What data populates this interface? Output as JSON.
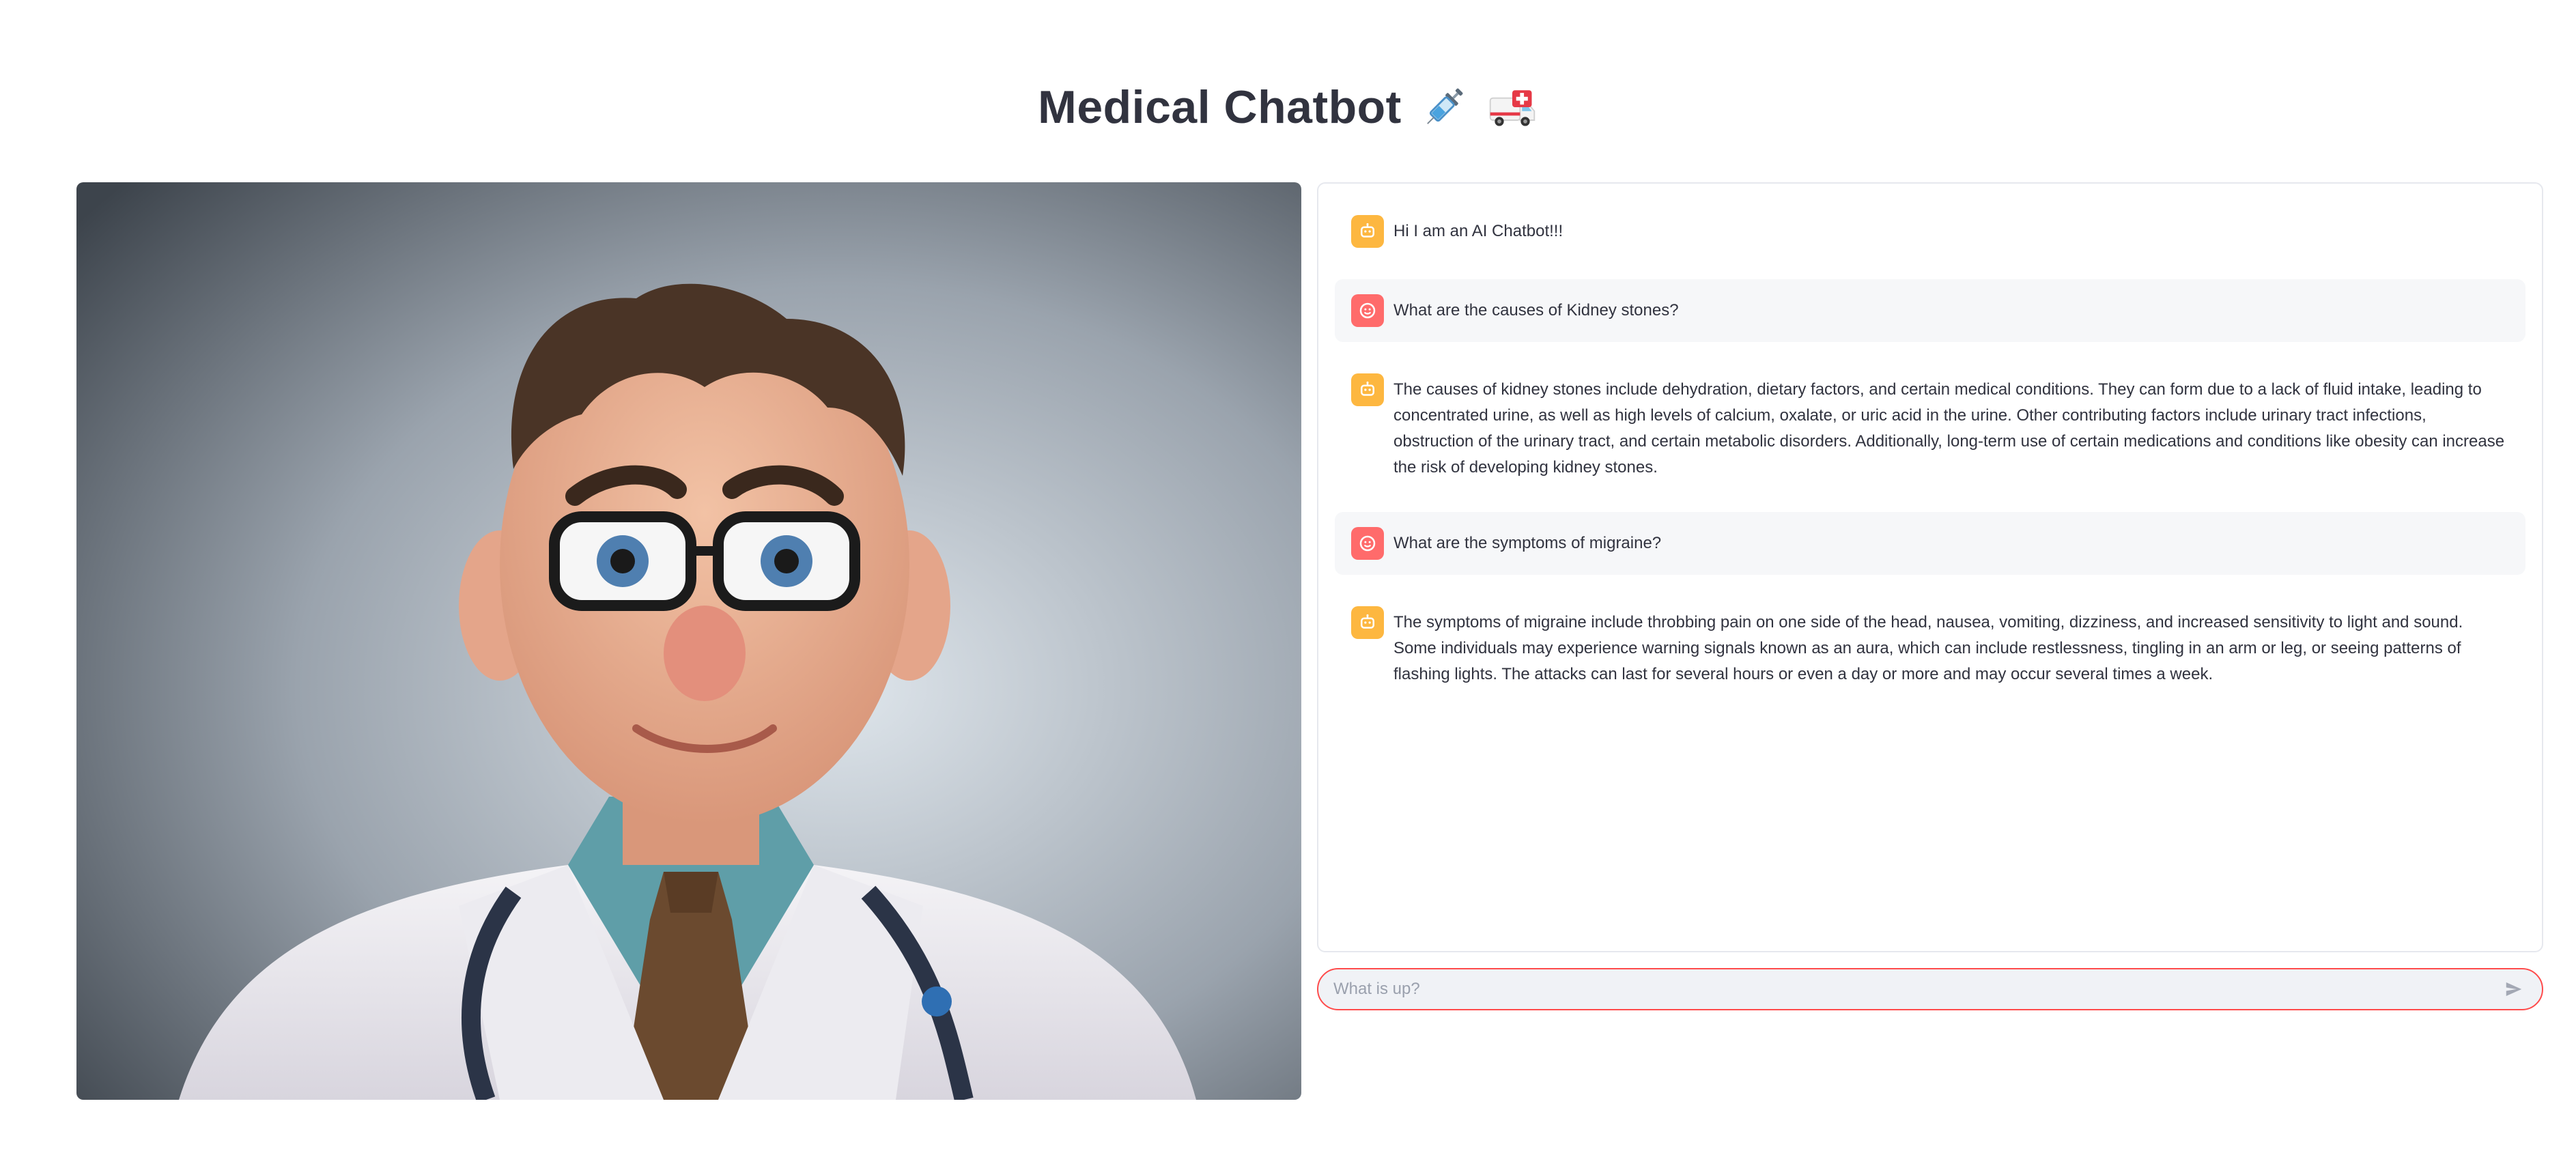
{
  "header": {
    "title": "Medical Chatbot",
    "emojis": [
      "syringe-icon",
      "ambulance-icon"
    ]
  },
  "portrait": {
    "subject": "doctor-illustration"
  },
  "chat": {
    "messages": [
      {
        "role": "assistant",
        "avatar_icon": "bot-face-icon",
        "text": "Hi I am an AI Chatbot!!!"
      },
      {
        "role": "user",
        "avatar_icon": "user-face-icon",
        "text": "What are the causes of Kidney stones?"
      },
      {
        "role": "assistant",
        "avatar_icon": "bot-face-icon",
        "text": "The causes of kidney stones include dehydration, dietary factors, and certain medical conditions. They can form due to a lack of fluid intake, leading to concentrated urine, as well as high levels of calcium, oxalate, or uric acid in the urine. Other contributing factors include urinary tract infections, obstruction of the urinary tract, and certain metabolic disorders. Additionally, long-term use of certain medications and conditions like obesity can increase the risk of developing kidney stones."
      },
      {
        "role": "user",
        "avatar_icon": "user-face-icon",
        "text": "What are the symptoms of migraine?"
      },
      {
        "role": "assistant",
        "avatar_icon": "bot-face-icon",
        "text": "The symptoms of migraine include throbbing pain on one side of the head, nausea, vomiting, dizziness, and increased sensitivity to light and sound. Some individuals may experience warning signals known as an aura, which can include restlessness, tingling in an arm or leg, or seeing patterns of flashing lights. The attacks can last for several hours or even a day or more and may occur several times a week."
      }
    ]
  },
  "input": {
    "placeholder": "What is up?",
    "value": ""
  },
  "colors": {
    "accent": "#ff4b4b",
    "bot_avatar": "#fdb740",
    "user_avatar": "#ff6b6b",
    "user_bubble": "#f6f7f9"
  }
}
